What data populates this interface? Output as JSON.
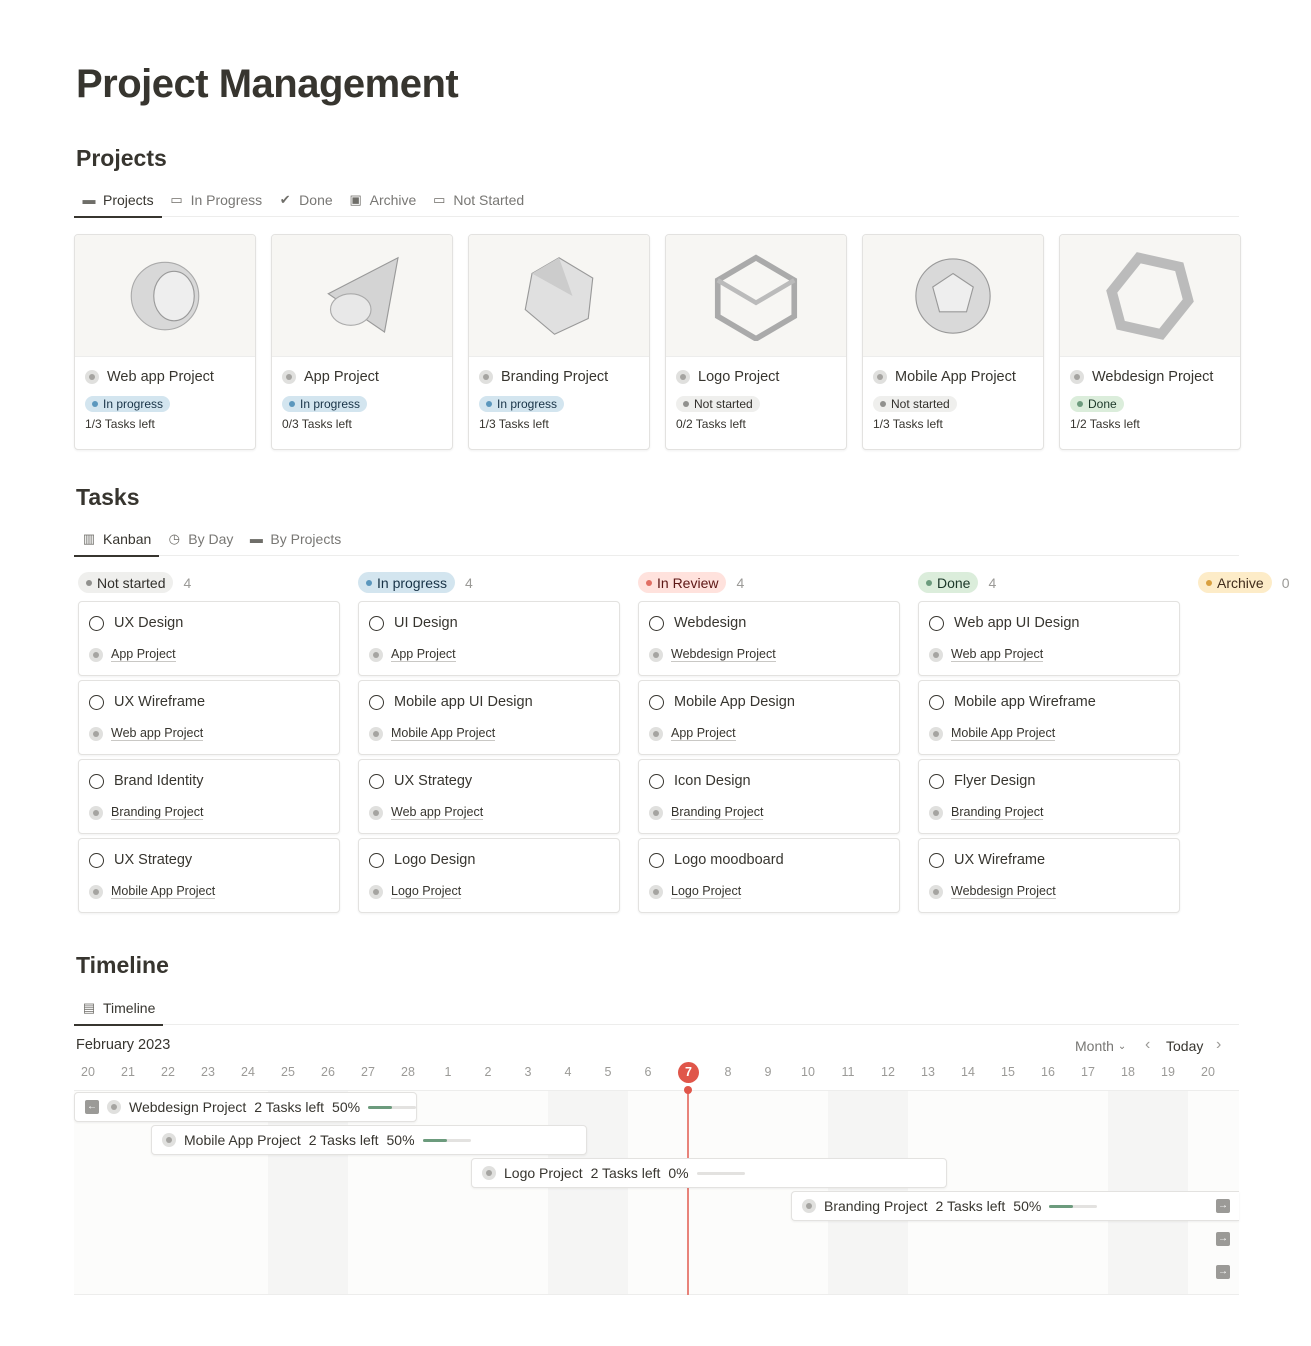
{
  "title": "Project Management",
  "projects": {
    "heading": "Projects",
    "tabs": [
      {
        "label": "Projects",
        "icon": "folder-icon"
      },
      {
        "label": "In Progress",
        "icon": "monitor-icon"
      },
      {
        "label": "Done",
        "icon": "check-circle-icon"
      },
      {
        "label": "Archive",
        "icon": "archive-icon"
      },
      {
        "label": "Not Started",
        "icon": "monitor-icon"
      }
    ],
    "cards": [
      {
        "name": "Web app Project",
        "status": "In progress",
        "tasks": "1/3 Tasks left",
        "shape": "sphere"
      },
      {
        "name": "App Project",
        "status": "In progress",
        "tasks": "0/3 Tasks left",
        "shape": "cone"
      },
      {
        "name": "Branding Project",
        "status": "In progress",
        "tasks": "1/3 Tasks left",
        "shape": "gem"
      },
      {
        "name": "Logo Project",
        "status": "Not started",
        "tasks": "0/2 Tasks left",
        "shape": "cube"
      },
      {
        "name": "Mobile App Project",
        "status": "Not started",
        "tasks": "1/3 Tasks left",
        "shape": "polyhedron"
      },
      {
        "name": "Webdesign Project",
        "status": "Done",
        "tasks": "1/2 Tasks left",
        "shape": "hexagon-ring"
      }
    ]
  },
  "status_colors": {
    "In progress": {
      "bg": "#d3e5ef",
      "dot": "#5b97bd",
      "fg": "#183347"
    },
    "Not started": {
      "bg": "#efefed",
      "dot": "#91918e",
      "fg": "#32302c"
    },
    "Done": {
      "bg": "#dbeddb",
      "dot": "#6c9b7d",
      "fg": "#1c3829"
    },
    "In Review": {
      "bg": "#ffe2dd",
      "dot": "#e16f64",
      "fg": "#5d1715"
    },
    "Archive": {
      "bg": "#fdecc8",
      "dot": "#d9a03f",
      "fg": "#402c1b"
    }
  },
  "tasks": {
    "heading": "Tasks",
    "tabs": [
      {
        "label": "Kanban",
        "icon": "columns-icon"
      },
      {
        "label": "By Day",
        "icon": "clock-icon"
      },
      {
        "label": "By Projects",
        "icon": "folder-icon"
      }
    ],
    "columns": [
      {
        "status": "Not started",
        "count": "4",
        "items": [
          {
            "title": "UX Design",
            "project": "App Project"
          },
          {
            "title": "UX Wireframe",
            "project": "Web app Project"
          },
          {
            "title": "Brand Identity",
            "project": "Branding Project"
          },
          {
            "title": "UX Strategy",
            "project": "Mobile App Project"
          }
        ]
      },
      {
        "status": "In progress",
        "count": "4",
        "items": [
          {
            "title": "UI Design",
            "project": "App Project"
          },
          {
            "title": "Mobile app UI Design",
            "project": "Mobile App Project"
          },
          {
            "title": "UX Strategy",
            "project": "Web app Project"
          },
          {
            "title": "Logo Design",
            "project": "Logo Project"
          }
        ]
      },
      {
        "status": "In Review",
        "count": "4",
        "items": [
          {
            "title": "Webdesign",
            "project": "Webdesign Project"
          },
          {
            "title": "Mobile App Design",
            "project": "App Project"
          },
          {
            "title": "Icon Design",
            "project": "Branding Project"
          },
          {
            "title": "Logo moodboard",
            "project": "Logo Project"
          }
        ]
      },
      {
        "status": "Done",
        "count": "4",
        "items": [
          {
            "title": "Web app UI Design",
            "project": "Web app Project"
          },
          {
            "title": "Mobile app Wireframe",
            "project": "Mobile App Project"
          },
          {
            "title": "Flyer Design",
            "project": "Branding Project"
          },
          {
            "title": "UX Wireframe",
            "project": "Webdesign Project"
          }
        ]
      },
      {
        "status": "Archive",
        "count": "0",
        "items": []
      }
    ]
  },
  "timeline": {
    "heading": "Timeline",
    "tab": "Timeline",
    "month": "February 2023",
    "view": "Month",
    "today_label": "Today",
    "days": [
      "20",
      "21",
      "22",
      "23",
      "24",
      "25",
      "26",
      "27",
      "28",
      "1",
      "2",
      "3",
      "4",
      "5",
      "6",
      "7",
      "8",
      "9",
      "10",
      "11",
      "12",
      "13",
      "14",
      "15",
      "16",
      "17",
      "18",
      "19",
      "20"
    ],
    "today": "7",
    "bars": [
      {
        "name": "Webdesign Project",
        "tasks": "2 Tasks left",
        "pct": "50%",
        "progress": 0.5
      },
      {
        "name": "Mobile App Project",
        "tasks": "2 Tasks left",
        "pct": "50%",
        "progress": 0.5
      },
      {
        "name": "Logo Project",
        "tasks": "2 Tasks left",
        "pct": "0%",
        "progress": 0
      },
      {
        "name": "Branding Project",
        "tasks": "2 Tasks left",
        "pct": "50%",
        "progress": 0.5
      }
    ]
  }
}
